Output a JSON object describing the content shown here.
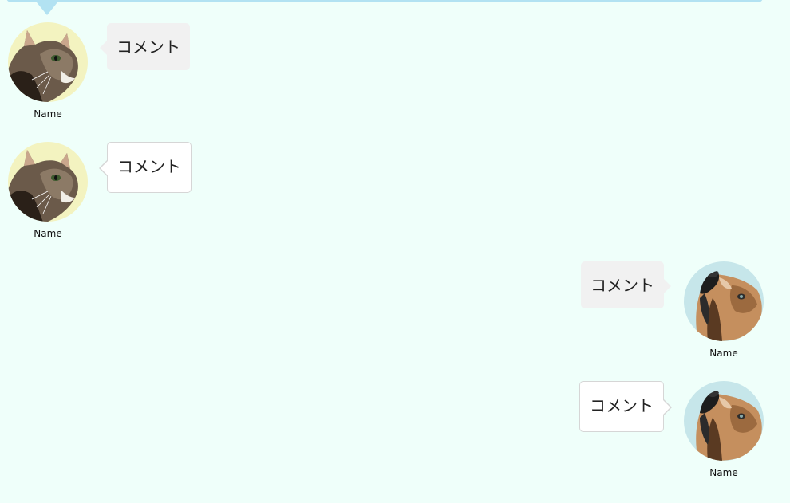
{
  "colors": {
    "background": "#effffa",
    "header_bar": "#b2e2f2",
    "filled_bubble": "#f1f1f1",
    "outlined_bubble_border": "#d6d6d6",
    "cat_avatar_bg": "#f3f3c0",
    "dog_avatar_bg": "#c6e6ea"
  },
  "messages": [
    {
      "side": "left",
      "style": "filled",
      "avatar": "cat-avatar",
      "name": "Name",
      "comment": "コメント"
    },
    {
      "side": "left",
      "style": "outlined",
      "avatar": "cat-avatar",
      "name": "Name",
      "comment": "コメント"
    },
    {
      "side": "right",
      "style": "filled",
      "avatar": "dog-avatar",
      "name": "Name",
      "comment": "コメント"
    },
    {
      "side": "right",
      "style": "outlined",
      "avatar": "dog-avatar",
      "name": "Name",
      "comment": "コメント"
    }
  ]
}
